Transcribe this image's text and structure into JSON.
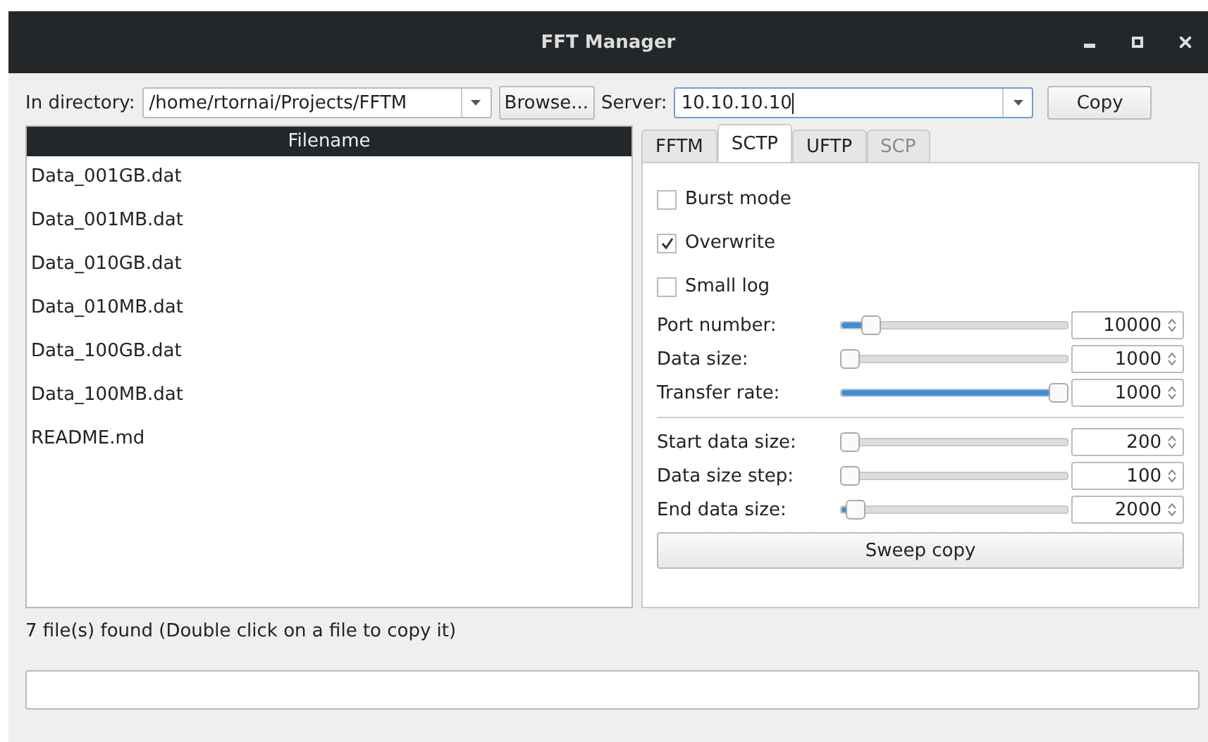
{
  "window": {
    "title": "FFT Manager"
  },
  "directory": {
    "label": "In directory:",
    "value": "/home/rtornai/Projects/FFTM"
  },
  "browse_button": "Browse...",
  "server": {
    "label": "Server:",
    "value": "10.10.10.10"
  },
  "copy_button": "Copy",
  "file_list": {
    "header": "Filename",
    "items": [
      "Data_001GB.dat",
      "Data_001MB.dat",
      "Data_010GB.dat",
      "Data_010MB.dat",
      "Data_100GB.dat",
      "Data_100MB.dat",
      "README.md"
    ]
  },
  "tabs": [
    {
      "label": "FFTM",
      "selected": false,
      "disabled": false
    },
    {
      "label": "SCTP",
      "selected": true,
      "disabled": false
    },
    {
      "label": "UFTP",
      "selected": false,
      "disabled": false
    },
    {
      "label": "SCP",
      "selected": false,
      "disabled": true
    }
  ],
  "options": [
    {
      "label": "Burst mode",
      "checked": false
    },
    {
      "label": "Overwrite",
      "checked": true
    },
    {
      "label": "Small log",
      "checked": false
    }
  ],
  "sliders": [
    {
      "label": "Port number:",
      "level": 0.1,
      "value": "10000"
    },
    {
      "label": "Data size:",
      "level": 0.0,
      "value": "1000"
    },
    {
      "label": "Transfer rate:",
      "level": 1.0,
      "value": "1000"
    }
  ],
  "sweep_sliders": [
    {
      "label": "Start data size:",
      "level": 0.0,
      "value": "200"
    },
    {
      "label": "Data size step:",
      "level": 0.0,
      "value": "100"
    },
    {
      "label": "End data size:",
      "level": 0.03,
      "value": "2000"
    }
  ],
  "sweep_button": "Sweep copy",
  "status": "7 file(s) found (Double click on a file to copy it)"
}
